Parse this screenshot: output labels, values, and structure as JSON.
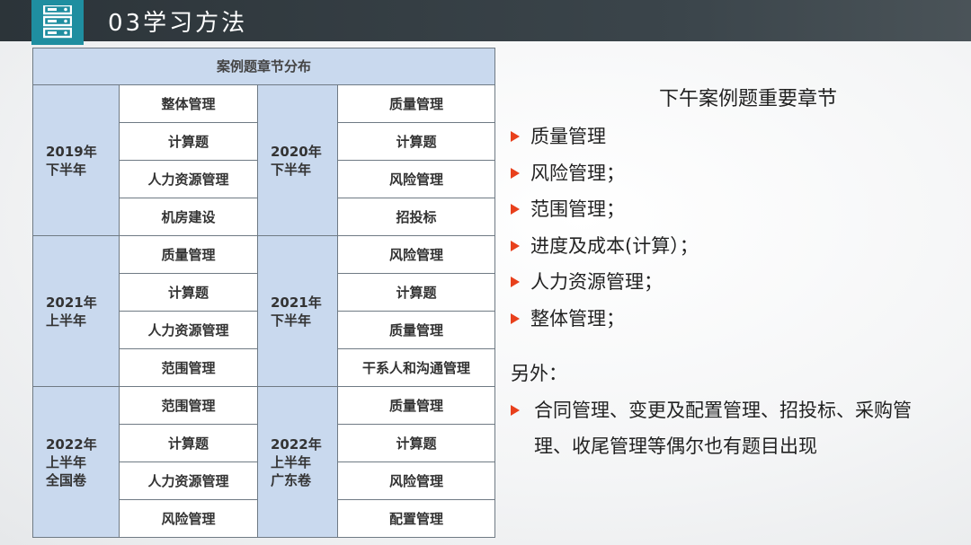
{
  "header": {
    "title": "03学习方法"
  },
  "table": {
    "caption": "案例题章节分布",
    "rows": [
      {
        "left_period": "2019年\n下半年",
        "left_items": [
          "整体管理",
          "计算题",
          "人力资源管理",
          "机房建设"
        ],
        "right_period": "2020年\n下半年",
        "right_items": [
          "质量管理",
          "计算题",
          "风险管理",
          "招投标"
        ]
      },
      {
        "left_period": "2021年\n上半年",
        "left_items": [
          "质量管理",
          "计算题",
          "人力资源管理",
          "范围管理"
        ],
        "right_period": "2021年\n下半年",
        "right_items": [
          "风险管理",
          "计算题",
          "质量管理",
          "干系人和沟通管理"
        ]
      },
      {
        "left_period": "2022年\n上半年\n全国卷",
        "left_items": [
          "范围管理",
          "计算题",
          "人力资源管理",
          "风险管理"
        ],
        "right_period": "2022年\n上半年\n广东卷",
        "right_items": [
          "质量管理",
          "计算题",
          "风险管理",
          "配置管理"
        ]
      }
    ]
  },
  "right": {
    "title": "下午案例题重要章节",
    "bullets": [
      "质量管理",
      "风险管理；",
      "范围管理；",
      "进度及成本(计算）；",
      "人力资源管理；",
      "整体管理；"
    ],
    "also_label": "另外：",
    "extra": "合同管理、变更及配置管理、招投标、采购管理、收尾管理等偶尔也有题目出现"
  },
  "colors": {
    "header_bg": "#353e43",
    "icon_bg": "#1f8ea0",
    "table_header_bg": "#c9d9ee",
    "arrow": "#e8401c"
  },
  "icons": {
    "header": "server-stack-icon",
    "bullet": "arrow-right-icon"
  }
}
